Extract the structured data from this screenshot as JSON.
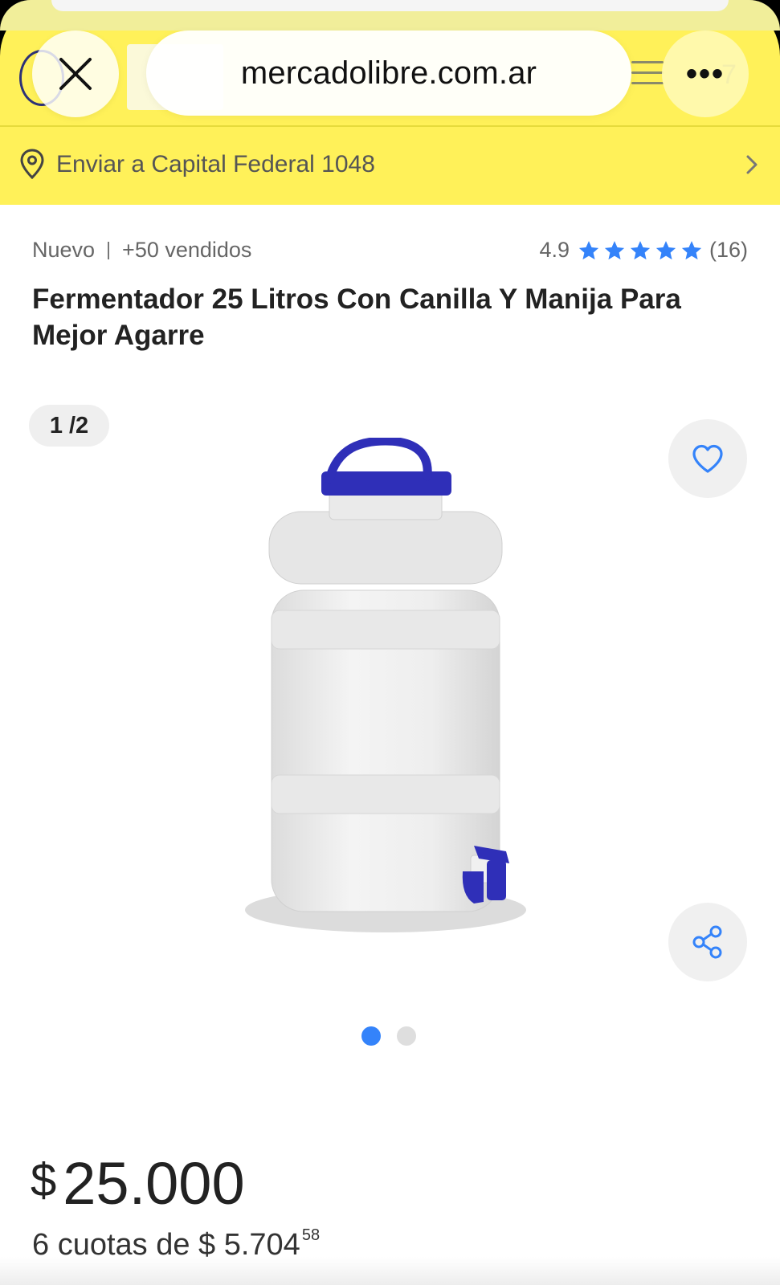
{
  "browser": {
    "url": "mercadolibre.com.ar",
    "close_icon": "close-icon",
    "more_icon": "more-dots-icon",
    "more_label": "•••"
  },
  "shipping": {
    "text": "Enviar a Capital Federal 1048",
    "icon": "location-pin-icon"
  },
  "product": {
    "condition": "Nuevo",
    "sold": "+50 vendidos",
    "rating_score": "4.9",
    "rating_stars": 5,
    "rating_count": "(16)",
    "title": "Fermentador 25 Litros Con Canilla Y Manija Para Mejor Agarre"
  },
  "gallery": {
    "counter": "1 /2",
    "total_images": 2,
    "active_index": 0
  },
  "price": {
    "currency": "$",
    "amount": "25.000",
    "installments_prefix": "6 cuotas de $ 5.704",
    "installments_cents": "58"
  },
  "colors": {
    "brand_yellow": "#fff159",
    "accent_blue": "#3483fa",
    "product_blue": "#2f2fb8"
  }
}
